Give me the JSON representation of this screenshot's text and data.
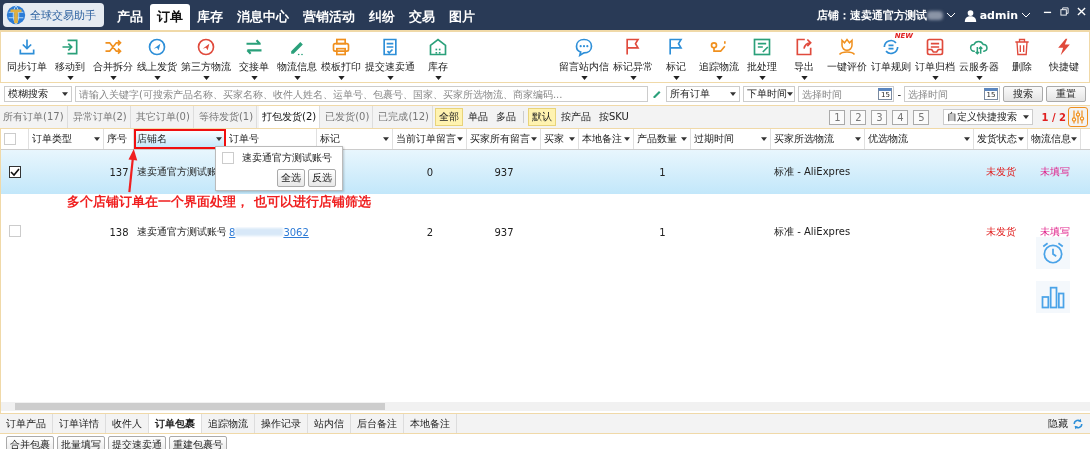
{
  "app": {
    "name": "全球交易助手"
  },
  "main_tabs": [
    {
      "label": "产品",
      "selected": false
    },
    {
      "label": "订单",
      "selected": true
    },
    {
      "label": "库存",
      "selected": false
    },
    {
      "label": "消息中心",
      "selected": false
    },
    {
      "label": "营销活动",
      "selected": false
    },
    {
      "label": "纠纷",
      "selected": false
    },
    {
      "label": "交易",
      "selected": false
    },
    {
      "label": "图片",
      "selected": false
    }
  ],
  "shop": {
    "label": "店铺：",
    "value": "速卖通官方测试"
  },
  "user": {
    "name": "admin"
  },
  "toolbar_left": [
    {
      "label": "同步订单",
      "has_menu": true
    },
    {
      "label": "移动到",
      "has_menu": true
    },
    {
      "label": "合并拆分",
      "has_menu": true
    },
    {
      "label": "线上发货",
      "has_menu": true
    },
    {
      "label": "第三方物流",
      "has_menu": true
    },
    {
      "label": "交接单",
      "has_menu": true
    },
    {
      "label": "物流信息",
      "has_menu": true
    },
    {
      "label": "模板打印",
      "has_menu": true
    },
    {
      "label": "提交速卖通",
      "has_menu": true
    },
    {
      "label": "库存",
      "has_menu": true
    }
  ],
  "toolbar_right": [
    {
      "label": "留言站内信",
      "has_menu": true
    },
    {
      "label": "标记异常",
      "has_menu": true
    },
    {
      "label": "标记",
      "has_menu": true
    },
    {
      "label": "追踪物流",
      "has_menu": true
    },
    {
      "label": "批处理",
      "has_menu": true
    },
    {
      "label": "导出",
      "has_menu": true
    },
    {
      "label": "一键评价",
      "has_menu": false
    },
    {
      "label": "订单规则",
      "has_menu": false,
      "badge": "NEW"
    },
    {
      "label": "订单归档",
      "has_menu": true
    },
    {
      "label": "云服务器",
      "has_menu": true
    },
    {
      "label": "删除",
      "has_menu": false
    },
    {
      "label": "快捷键",
      "has_menu": false
    }
  ],
  "search": {
    "mode": "模糊搜索",
    "placeholder": "请输入关键字(可搜索产品名称、买家名称、收件人姓名、运单号、包裹号、国家、买家所选物流、商家编码...",
    "order_filter": "所有订单",
    "time_field": "下单时间",
    "date_from_placeholder": "选择时间",
    "date_from_calendar": "15",
    "date_separator": "-",
    "date_to_placeholder": "选择时间",
    "date_to_calendar": "15",
    "search_button": "搜索",
    "reset_button": "重置"
  },
  "status_tabs": [
    {
      "label": "所有订单(17)",
      "selected": false
    },
    {
      "label": "异常订单(2)",
      "selected": false
    },
    {
      "label": "其它订单(0)",
      "selected": false
    },
    {
      "label": "等待发货(1)",
      "selected": false
    },
    {
      "label": "打包发货(2)",
      "selected": true
    },
    {
      "label": "已发货(0)",
      "selected": false
    },
    {
      "label": "已完成(12)",
      "selected": false
    }
  ],
  "item_filters": [
    {
      "label": "全部",
      "selected": true
    },
    {
      "label": "单品",
      "selected": false
    },
    {
      "label": "多品",
      "selected": false
    }
  ],
  "sort_filters": [
    {
      "label": "默认",
      "selected": true
    },
    {
      "label": "按产品",
      "selected": false
    },
    {
      "label": "按SKU",
      "selected": false
    }
  ],
  "pages": [
    {
      "label": "1"
    },
    {
      "label": "2"
    },
    {
      "label": "3"
    },
    {
      "label": "4"
    },
    {
      "label": "5"
    }
  ],
  "quick_search": "自定义快捷搜索",
  "page_indicator": "1 / 2",
  "table": {
    "select_all_checked": false,
    "columns": [
      {
        "label": "订单类型",
        "has_menu": true,
        "highlighted": false
      },
      {
        "label": "序号",
        "has_menu": false,
        "highlighted": false
      },
      {
        "label": "店铺名",
        "has_menu": true,
        "highlighted": true
      },
      {
        "label": "订单号",
        "has_menu": false,
        "highlighted": false
      },
      {
        "label": "标记",
        "has_menu": true,
        "highlighted": false
      },
      {
        "label": "当前订单留言",
        "has_menu": true,
        "highlighted": false
      },
      {
        "label": "买家所有留言",
        "has_menu": true,
        "highlighted": false
      },
      {
        "label": "买家",
        "has_menu": true,
        "highlighted": false
      },
      {
        "label": "本地备注",
        "has_menu": true,
        "highlighted": false
      },
      {
        "label": "产品数量",
        "has_menu": true,
        "highlighted": false
      },
      {
        "label": "过期时间",
        "has_menu": true,
        "highlighted": false
      },
      {
        "label": "买家所选物流",
        "has_menu": true,
        "highlighted": false
      },
      {
        "label": "优选物流",
        "has_menu": true,
        "highlighted": false
      },
      {
        "label": "发货状态",
        "has_menu": true,
        "highlighted": false
      },
      {
        "label": "物流信息",
        "has_menu": true,
        "highlighted": false
      }
    ],
    "rows": [
      {
        "selected": true,
        "cells": [
          "",
          "137",
          "速卖通官方测试账",
          "",
          "",
          "0",
          "937",
          "",
          "",
          "1",
          "",
          "标准 - AliExpres",
          "",
          "未发货",
          "未填写"
        ],
        "order_link_parts": []
      },
      {
        "selected": false,
        "cells": [
          "",
          "138",
          "速卖通官方测试账号",
          "",
          "",
          "2",
          "937",
          "",
          "",
          "1",
          "",
          "标准 - AliExpres",
          "",
          "未发货",
          "未填写"
        ],
        "order_link_parts": [
          "8",
          "3062"
        ]
      }
    ]
  },
  "shop_filter_popup": {
    "options": [
      {
        "label": "速卖通官方测试账号",
        "checked": false
      }
    ],
    "select_all": "全选",
    "invert": "反选"
  },
  "annotation": "多个店铺订单在一个界面处理， 也可以进行店铺筛选",
  "detail_tabs": [
    {
      "label": "订单产品",
      "selected": false
    },
    {
      "label": "订单详情",
      "selected": false
    },
    {
      "label": "收件人",
      "selected": false
    },
    {
      "label": "订单包裹",
      "selected": true
    },
    {
      "label": "追踪物流",
      "selected": false
    },
    {
      "label": "操作记录",
      "selected": false
    },
    {
      "label": "站内信",
      "selected": false
    },
    {
      "label": "后台备注",
      "selected": false
    },
    {
      "label": "本地备注",
      "selected": false
    }
  ],
  "hide_button": "隐藏",
  "detail_buttons": [
    "合并包裹",
    "批量填写",
    "提交速卖通",
    "重建包裹号"
  ]
}
